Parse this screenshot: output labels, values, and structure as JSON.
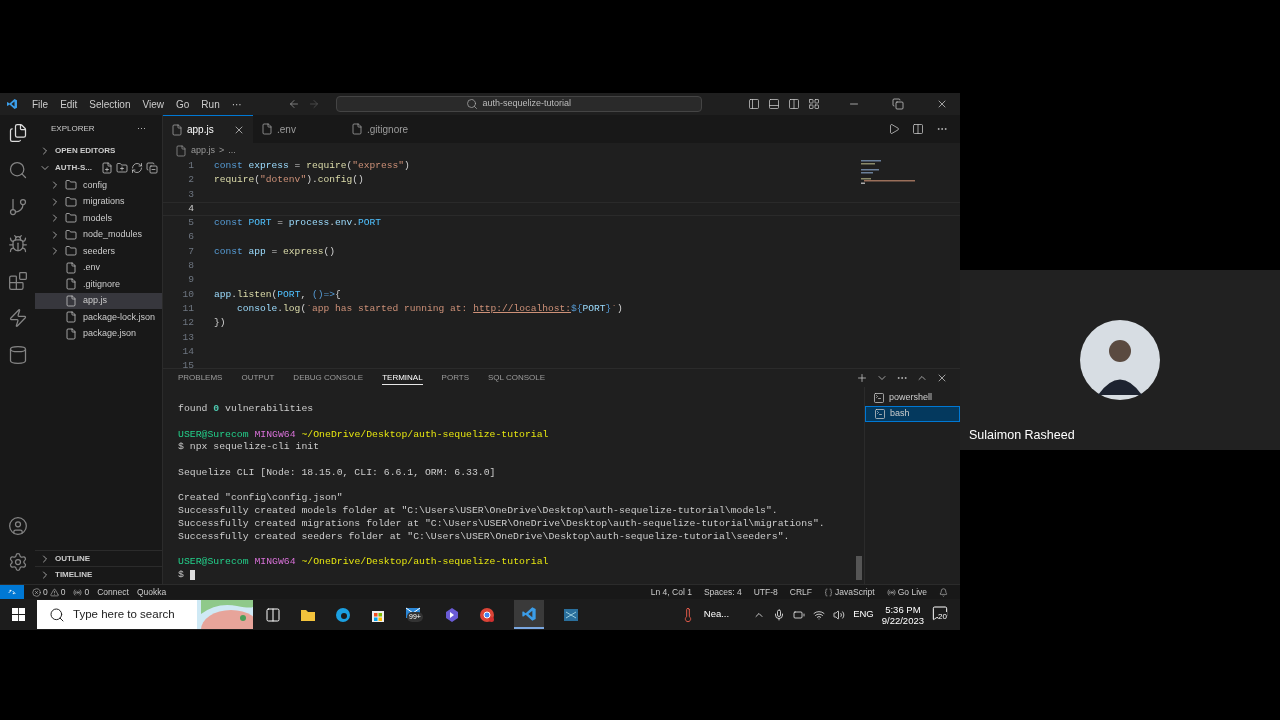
{
  "menu": [
    "File",
    "Edit",
    "Selection",
    "View",
    "Go",
    "Run",
    "···"
  ],
  "command_center": {
    "placeholder": "auth-sequelize-tutorial"
  },
  "explorer": {
    "title": "EXPLORER",
    "more": "···",
    "sections": [
      {
        "label": "OPEN EDITORS",
        "expanded": false
      }
    ],
    "root": {
      "label": "AUTH-S...",
      "expanded": true,
      "children": [
        {
          "label": "config",
          "kind": "folder",
          "expanded": false,
          "selected": false
        },
        {
          "label": "migrations",
          "kind": "folder",
          "expanded": false,
          "selected": false
        },
        {
          "label": "models",
          "kind": "folder",
          "expanded": false,
          "selected": false
        },
        {
          "label": "node_modules",
          "kind": "folder",
          "expanded": false,
          "selected": false
        },
        {
          "label": "seeders",
          "kind": "folder",
          "expanded": false,
          "selected": false
        },
        {
          "label": ".env",
          "kind": "file",
          "selected": false
        },
        {
          "label": ".gitignore",
          "kind": "file",
          "selected": false
        },
        {
          "label": "app.js",
          "kind": "file",
          "selected": true
        },
        {
          "label": "package-lock.json",
          "kind": "file",
          "selected": false
        },
        {
          "label": "package.json",
          "kind": "file",
          "selected": false
        }
      ]
    },
    "bottom_sections": [
      {
        "label": "OUTLINE",
        "expanded": false
      },
      {
        "label": "TIMELINE",
        "expanded": false
      }
    ]
  },
  "tabs": [
    {
      "label": "app.js",
      "selected": true
    },
    {
      "label": ".env",
      "selected": false
    },
    {
      "label": ".gitignore",
      "selected": false
    }
  ],
  "breadcrumb": [
    "app.js",
    ">",
    "..."
  ],
  "editor": {
    "lines": [
      {
        "n": "1",
        "current": false,
        "tokens": [
          {
            "kind": "kw",
            "text": "const "
          },
          {
            "kind": "var",
            "text": "express"
          },
          {
            "kind": "p",
            "text": " = "
          },
          {
            "kind": "fn",
            "text": "require"
          },
          {
            "kind": "p",
            "text": "("
          },
          {
            "kind": "str",
            "text": "\"express\""
          },
          {
            "kind": "p",
            "text": ")"
          }
        ]
      },
      {
        "n": "2",
        "current": false,
        "tokens": [
          {
            "kind": "fn",
            "text": "require"
          },
          {
            "kind": "p",
            "text": "("
          },
          {
            "kind": "str",
            "text": "\"dotenv\""
          },
          {
            "kind": "p",
            "text": ")."
          },
          {
            "kind": "fn",
            "text": "config"
          },
          {
            "kind": "p",
            "text": "()"
          }
        ]
      },
      {
        "n": "3",
        "current": false
      },
      {
        "n": "4",
        "current": true
      },
      {
        "n": "5",
        "current": false,
        "tokens": [
          {
            "kind": "kw",
            "text": "const "
          },
          {
            "kind": "const",
            "text": "PORT"
          },
          {
            "kind": "p",
            "text": " = "
          },
          {
            "kind": "var",
            "text": "process"
          },
          {
            "kind": "p",
            "text": "."
          },
          {
            "kind": "var",
            "text": "env"
          },
          {
            "kind": "p",
            "text": "."
          },
          {
            "kind": "const",
            "text": "PORT"
          }
        ]
      },
      {
        "n": "6",
        "current": false
      },
      {
        "n": "7",
        "current": false,
        "tokens": [
          {
            "kind": "kw",
            "text": "const "
          },
          {
            "kind": "var",
            "text": "app"
          },
          {
            "kind": "p",
            "text": " = "
          },
          {
            "kind": "fn",
            "text": "express"
          },
          {
            "kind": "p",
            "text": "()"
          }
        ]
      },
      {
        "n": "8",
        "current": false
      },
      {
        "n": "9",
        "current": false
      },
      {
        "n": "10",
        "current": false,
        "tokens": [
          {
            "kind": "var",
            "text": "app"
          },
          {
            "kind": "p",
            "text": "."
          },
          {
            "kind": "fn",
            "text": "listen"
          },
          {
            "kind": "p",
            "text": "("
          },
          {
            "kind": "const",
            "text": "PORT"
          },
          {
            "kind": "p",
            "text": ", "
          },
          {
            "kind": "kw",
            "text": "()=>"
          },
          {
            "kind": "p",
            "text": "{"
          }
        ]
      },
      {
        "n": "11",
        "current": false,
        "tokens": [
          {
            "kind": "var",
            "text": "    console"
          },
          {
            "kind": "p",
            "text": "."
          },
          {
            "kind": "fn",
            "text": "log"
          },
          {
            "kind": "p",
            "text": "("
          },
          {
            "kind": "str",
            "text": "`app has started running at: "
          },
          {
            "kind": "url",
            "text": "http://localhost:"
          },
          {
            "kind": "kw",
            "text": "${"
          },
          {
            "kind": "var",
            "text": "PORT"
          },
          {
            "kind": "kw",
            "text": "}"
          },
          {
            "kind": "str",
            "text": "`"
          },
          {
            "kind": "p",
            "text": ")"
          }
        ]
      },
      {
        "n": "12",
        "current": false,
        "tokens": [
          {
            "kind": "p",
            "text": "})"
          }
        ]
      },
      {
        "n": "13",
        "current": false
      },
      {
        "n": "14",
        "current": false
      },
      {
        "n": "15",
        "current": false
      }
    ]
  },
  "panel_tabs": [
    {
      "label": "PROBLEMS",
      "selected": false
    },
    {
      "label": "OUTPUT",
      "selected": false
    },
    {
      "label": "DEBUG CONSOLE",
      "selected": false
    },
    {
      "label": "TERMINAL",
      "selected": true
    },
    {
      "label": "PORTS",
      "selected": false
    },
    {
      "label": "SQL CONSOLE",
      "selected": false
    }
  ],
  "terminal": {
    "lines": [
      {
        "tokens": [
          {
            "kind": "p",
            "text": "found "
          },
          {
            "kind": "num",
            "text": "0"
          },
          {
            "kind": "p",
            "text": " vulnerabilities"
          }
        ]
      },
      {
        "blank_before": true,
        "tokens": [
          {
            "kind": "user",
            "text": "USER@Surecom "
          },
          {
            "kind": "env",
            "text": "MINGW64 "
          },
          {
            "kind": "path",
            "text": "~/OneDrive/Desktop/auth-sequelize-tutorial"
          }
        ]
      },
      {
        "tokens": [
          {
            "kind": "p",
            "text": "$ npx sequelize-cli init"
          }
        ]
      },
      {
        "blank_before": true,
        "tokens": [
          {
            "kind": "p",
            "text": "Sequelize CLI [Node: 18.15.0, CLI: 6.6.1, ORM: 6.33.0]"
          }
        ]
      },
      {
        "blank_before": true,
        "tokens": [
          {
            "kind": "p",
            "text": "Created \"config\\config.json\""
          }
        ]
      },
      {
        "tokens": [
          {
            "kind": "p",
            "text": "Successfully created models folder at \"C:\\Users\\USER\\OneDrive\\Desktop\\auth-sequelize-tutorial\\models\"."
          }
        ]
      },
      {
        "tokens": [
          {
            "kind": "p",
            "text": "Successfully created migrations folder at \"C:\\Users\\USER\\OneDrive\\Desktop\\auth-sequelize-tutorial\\migrations\"."
          }
        ]
      },
      {
        "tokens": [
          {
            "kind": "p",
            "text": "Successfully created seeders folder at \"C:\\Users\\USER\\OneDrive\\Desktop\\auth-sequelize-tutorial\\seeders\"."
          }
        ]
      },
      {
        "blank_before": true,
        "tokens": [
          {
            "kind": "user",
            "text": "USER@Surecom "
          },
          {
            "kind": "env",
            "text": "MINGW64 "
          },
          {
            "kind": "path",
            "text": "~/OneDrive/Desktop/auth-sequelize-tutorial"
          }
        ]
      },
      {
        "tokens": [
          {
            "kind": "p",
            "text": "$"
          }
        ],
        "cursor": true
      }
    ],
    "shells": [
      {
        "label": "powershell",
        "selected": false
      },
      {
        "label": "bash",
        "selected": true
      }
    ]
  },
  "status_bar": {
    "errors": "0",
    "warnings": "0",
    "ports": "0",
    "left": [
      "Connect",
      "Quokka"
    ],
    "right": [
      "Ln 4, Col 1",
      "Spaces: 4",
      "UTF-8",
      "CRLF",
      "JavaScript",
      "Go Live"
    ]
  },
  "taskbar": {
    "search": {
      "placeholder": "Type here to search"
    },
    "mail_badge": "99+",
    "weather": "Nea...",
    "language": "ENG",
    "time": "5:36 PM",
    "date": "9/22/2023",
    "notifications": "20"
  },
  "participant": {
    "name": "Sulaimon Rasheed"
  }
}
